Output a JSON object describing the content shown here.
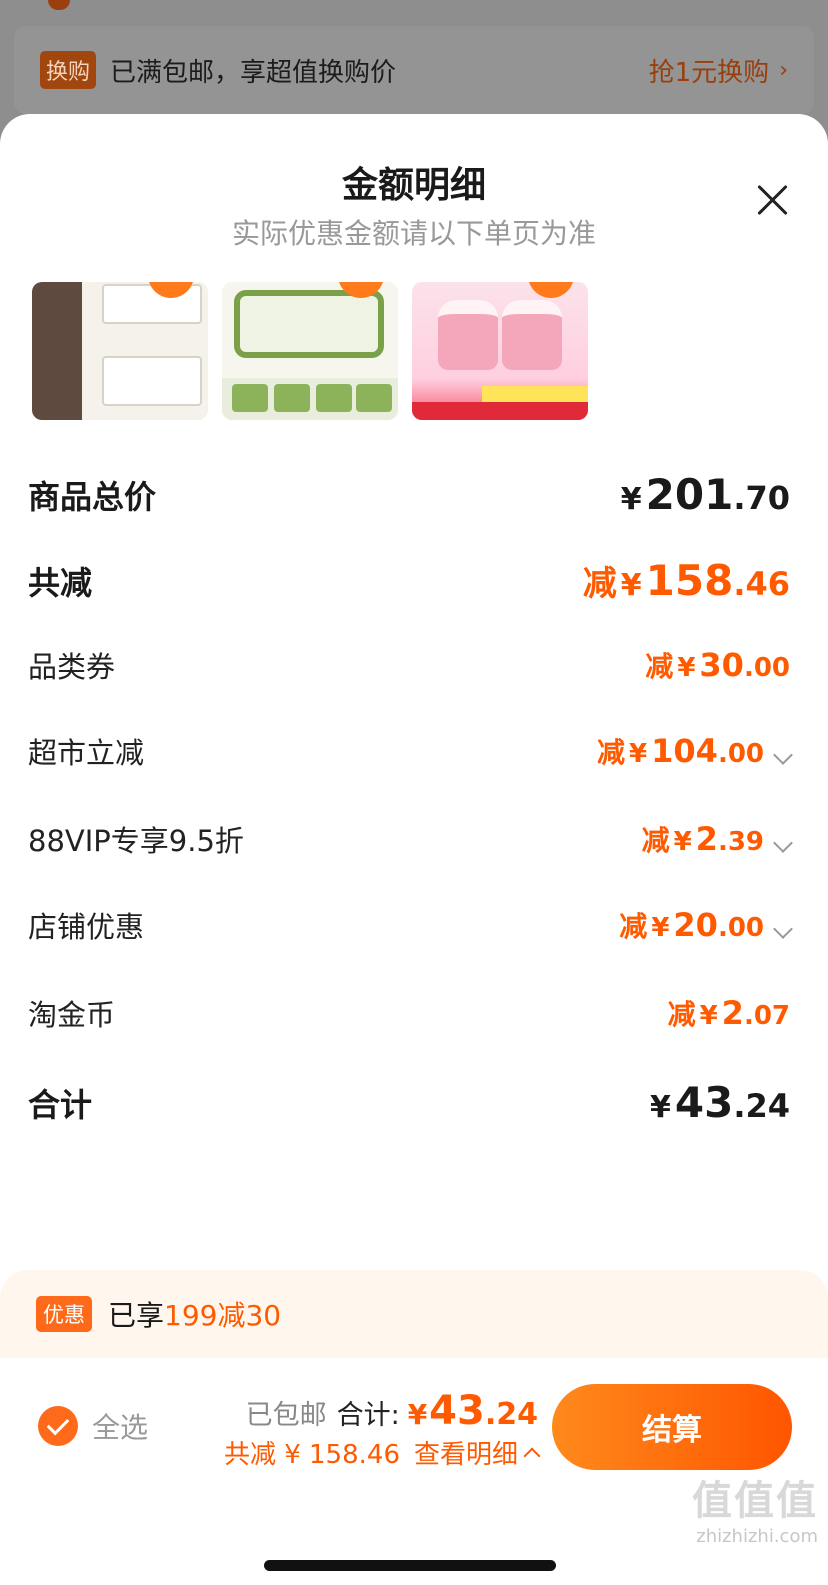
{
  "promo": {
    "tag": "换购",
    "text": "已满包邮，享超值换购价",
    "link": "抢1元换购",
    "chevron": "›"
  },
  "sheet": {
    "title": "金额明细",
    "subtitle": "实际优惠金额请以下单页为准"
  },
  "products": [
    {
      "name": "storage-drawer"
    },
    {
      "name": "lunch-box"
    },
    {
      "name": "baby-cream"
    }
  ],
  "rows": [
    {
      "label": "商品总价",
      "prefix": "",
      "yen": "¥",
      "int": "201",
      "dec": ".70",
      "color": "#1a1a1a",
      "expand": false,
      "bold": true
    },
    {
      "label": "共减",
      "prefix": "减",
      "yen": "¥",
      "int": "158",
      "dec": ".46",
      "color": "#ff5a00",
      "expand": false,
      "bold": true
    },
    {
      "label": "品类券",
      "prefix": "减",
      "yen": "¥",
      "int": "30",
      "dec": ".00",
      "color": "#ff5a00",
      "expand": false
    },
    {
      "label": "超市立减",
      "prefix": "减",
      "yen": "¥",
      "int": "104",
      "dec": ".00",
      "color": "#ff5a00",
      "expand": true
    },
    {
      "label": "88VIP专享9.5折",
      "prefix": "减",
      "yen": "¥",
      "int": "2",
      "dec": ".39",
      "color": "#ff5a00",
      "expand": true
    },
    {
      "label": "店铺优惠",
      "prefix": "减",
      "yen": "¥",
      "int": "20",
      "dec": ".00",
      "color": "#ff5a00",
      "expand": true
    },
    {
      "label": "淘金币",
      "prefix": "减",
      "yen": "¥",
      "int": "2",
      "dec": ".07",
      "color": "#ff5a00",
      "expand": false
    },
    {
      "label": "合计",
      "prefix": "",
      "yen": "¥",
      "int": "43",
      "dec": ".24",
      "color": "#1a1a1a",
      "expand": false,
      "bold": true
    }
  ],
  "deal": {
    "tag": "优惠",
    "prefix": "已享",
    "value": "199减30"
  },
  "footer": {
    "select_all": "全选",
    "shipping": "已包邮",
    "total_label": "合计:",
    "total_yen": "¥",
    "total_int": "43",
    "total_dec": ".24",
    "saved": "共减 ¥ 158.46",
    "detail": "查看明细",
    "checkout": "结算"
  },
  "watermark": {
    "line1": "值值值",
    "line2": "zhizhizhi.com"
  },
  "colors": {
    "accent": "#ff5a00",
    "button_start": "#ff8a1c",
    "button_end": "#ff5500"
  }
}
